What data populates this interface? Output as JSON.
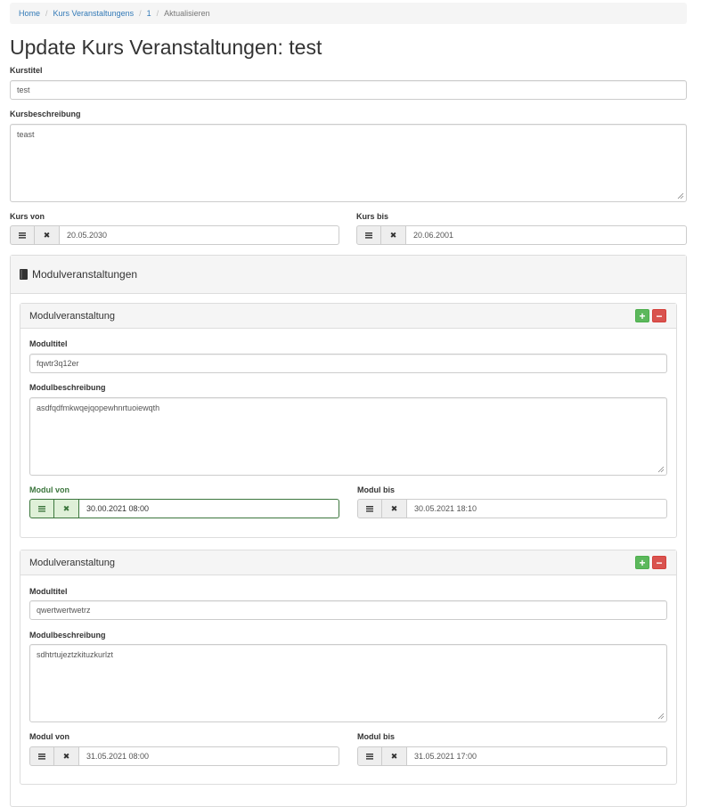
{
  "breadcrumb": {
    "items": [
      "Home",
      "Kurs Veranstaltungens",
      "1"
    ],
    "active": "Aktualisieren",
    "separator": "/"
  },
  "page_title": "Update Kurs Veranstaltungen: test",
  "form": {
    "kurstitel_label": "Kurstitel",
    "kurstitel_value": "test",
    "kursbeschreibung_label": "Kursbeschreibung",
    "kursbeschreibung_value": "teast",
    "kurs_von_label": "Kurs von",
    "kurs_von_value": "20.05.2030",
    "kurs_bis_label": "Kurs bis",
    "kurs_bis_value": "20.06.2001"
  },
  "modules_panel": {
    "title": "Modulveranstaltungen",
    "icon": "book-icon",
    "modules": [
      {
        "heading": "Modulveranstaltung",
        "titel_label": "Modultitel",
        "titel_value": "fqwtr3q12er",
        "beschreibung_label": "Modulbeschreibung",
        "beschreibung_value": "asdfqdfmkwqejqopewhnrtuoiewqth",
        "von_label": "Modul von",
        "von_value": "30.00.2021 08:00",
        "bis_label": "Modul bis",
        "bis_value": "30.05.2021 18:10"
      },
      {
        "heading": "Modulveranstaltung",
        "titel_label": "Modultitel",
        "titel_value": "qwertwertwetrz",
        "beschreibung_label": "Modulbeschreibung",
        "beschreibung_value": "sdhtrtujeztzkituzkurlzt",
        "von_label": "Modul von",
        "von_value": "31.05.2021 08:00",
        "bis_label": "Modul bis",
        "bis_value": "31.05.2021 17:00"
      }
    ]
  },
  "buttons": {
    "add": "+",
    "remove": "−"
  },
  "icons": {
    "calendar": "calendar-icon",
    "clear": "clear-icon",
    "book": "book-icon"
  },
  "colors": {
    "link": "#337ab7",
    "success": "#3c763d",
    "success_bg": "#dff0d8",
    "add_button": "#5cb85c",
    "remove_button": "#d9534f"
  }
}
